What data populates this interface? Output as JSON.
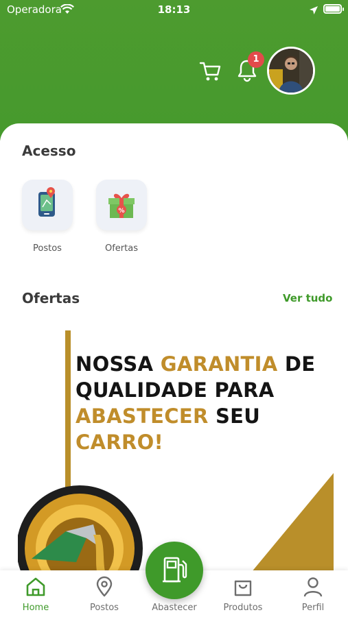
{
  "status_bar": {
    "carrier": "Operadora",
    "time": "18:13"
  },
  "header": {
    "notification_count": "1"
  },
  "acesso": {
    "title": "Acesso",
    "shortcuts": [
      {
        "label": "Postos",
        "icon": "map-pin-icon"
      },
      {
        "label": "Ofertas",
        "icon": "gift-icon"
      }
    ]
  },
  "ofertas": {
    "title": "Ofertas",
    "see_all": "Ver tudo",
    "banner": {
      "line1_a": "NOSSA ",
      "line1_b": "GARANTIA",
      "line1_c": " DE",
      "line2": "QUALIDADE PARA",
      "line3_a": "ABASTECER",
      "line3_b": " SEU ",
      "line3_c": "CARRO!"
    }
  },
  "tabbar": {
    "home": "Home",
    "postos": "Postos",
    "abastecer": "Abastecer",
    "produtos": "Produtos",
    "perfil": "Perfil"
  },
  "colors": {
    "brand_green": "#3f9a2a",
    "banner_gold": "#c08d2b",
    "badge_red": "#e24b4b"
  }
}
